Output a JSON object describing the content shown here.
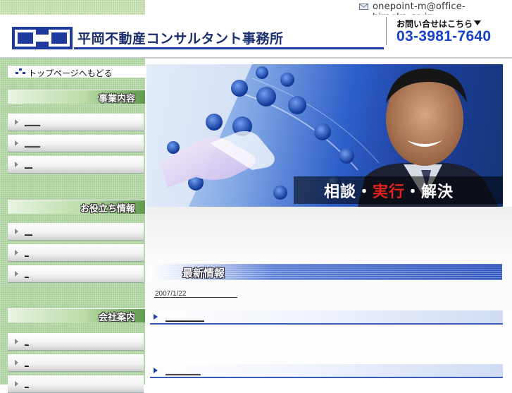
{
  "header": {
    "email": "onepoint-m@office-hiraoka.co.jp",
    "company_name": "平岡不動産コンサルタント事務所",
    "contact_label": "お問い合せはこちら",
    "phone": "03-3981-7640"
  },
  "sidebar": {
    "home_link": "トップページへもどる",
    "sections": [
      {
        "title": "事業内容",
        "items": [
          "____",
          "____",
          "__"
        ]
      },
      {
        "title": "お役立ち情報",
        "items": [
          "__",
          "_",
          "_"
        ]
      },
      {
        "title": "会社案内",
        "items": [
          "_",
          "_",
          "_"
        ]
      }
    ]
  },
  "hero": {
    "slogan_part1": "相談・",
    "slogan_part2": "実行",
    "slogan_part3": "・解決"
  },
  "news": {
    "title": "最新情報",
    "date": "2007/1/22",
    "items": [
      "__________",
      "_________"
    ]
  },
  "colors": {
    "brand_blue": "#1540c9",
    "sidebar_green": "#a9d09a",
    "slogan_red": "#e0231c"
  }
}
